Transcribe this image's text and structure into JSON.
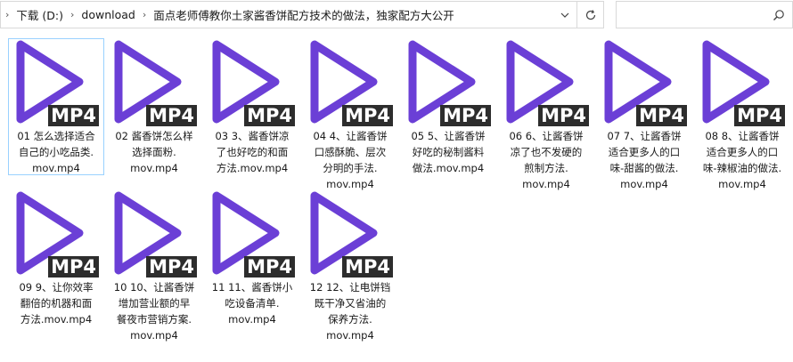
{
  "window": {
    "breadcrumb": [
      {
        "label": "下载 (D:)"
      },
      {
        "label": "download"
      },
      {
        "label": "面点老师傅教你土家酱香饼配方技术的做法，独家配方大公开"
      }
    ],
    "search": {
      "placeholder": ""
    }
  },
  "colors": {
    "play_icon": "#6b3fd6",
    "badge_bg": "#2d2d2d",
    "selection": "#99d1ff"
  },
  "files": [
    {
      "name": "01 怎么选择适合自己的小吃品类.mov.mp4",
      "lines": [
        "01 怎么选择适合",
        "自己的小吃品类.",
        "mov.mp4"
      ],
      "badge": "MP4",
      "icon": "play-icon",
      "selected": true
    },
    {
      "name": "02 酱香饼怎么样选择面粉.mov.mp4",
      "lines": [
        "02 酱香饼怎么样",
        "选择面粉.",
        "mov.mp4"
      ],
      "badge": "MP4",
      "icon": "play-icon"
    },
    {
      "name": "03 3、酱香饼凉了也好吃的和面方法.mov.mp4",
      "lines": [
        "03 3、酱香饼凉",
        "了也好吃的和面",
        "方法.mov.mp4"
      ],
      "badge": "MP4",
      "icon": "play-icon"
    },
    {
      "name": "04 4、让酱香饼口感酥脆、层次分明的手法.mov.mp4",
      "lines": [
        "04 4、让酱香饼",
        "口感酥脆、层次",
        "分明的手法.",
        "mov.mp4"
      ],
      "badge": "MP4",
      "icon": "play-icon"
    },
    {
      "name": "05 5、让酱香饼好吃的秘制酱料做法.mov.mp4",
      "lines": [
        "05 5、让酱香饼",
        "好吃的秘制酱料",
        "做法.mov.mp4"
      ],
      "badge": "MP4",
      "icon": "play-icon"
    },
    {
      "name": "06 6、让酱香饼凉了也不发硬的煎制方法.mov.mp4",
      "lines": [
        "06 6、让酱香饼",
        "凉了也不发硬的",
        "煎制方法.",
        "mov.mp4"
      ],
      "badge": "MP4",
      "icon": "play-icon"
    },
    {
      "name": "07 7、让酱香饼适合更多人的口味-甜酱的做法.mov.mp4",
      "lines": [
        "07 7、让酱香饼",
        "适合更多人的口",
        "味-甜酱的做法.",
        "mov.mp4"
      ],
      "badge": "MP4",
      "icon": "play-icon"
    },
    {
      "name": "08 8、让酱香饼适合更多人的口味-辣椒油的做法.mov.mp4",
      "lines": [
        "08 8、让酱香饼",
        "适合更多人的口",
        "味-辣椒油的做法.",
        "mov.mp4"
      ],
      "badge": "MP4",
      "icon": "play-icon"
    },
    {
      "name": "09 9、让你效率翻倍的机器和面方法.mov.mp4",
      "lines": [
        "09 9、让你效率",
        "翻倍的机器和面",
        "方法.mov.mp4"
      ],
      "badge": "MP4",
      "icon": "play-icon"
    },
    {
      "name": "10 10、让酱香饼增加营业额的早餐夜市营销方案.mov.mp4",
      "lines": [
        "10 10、让酱香饼",
        "增加营业额的早",
        "餐夜市营销方案.",
        "mov.mp4"
      ],
      "badge": "MP4",
      "icon": "play-icon"
    },
    {
      "name": "11 11、酱香饼小吃设备清单.mov.mp4",
      "lines": [
        "11 11、酱香饼小",
        "吃设备清单.",
        "mov.mp4"
      ],
      "badge": "MP4",
      "icon": "play-icon"
    },
    {
      "name": "12 12、让电饼铛既干净又省油的保养方法.mov.mp4",
      "lines": [
        "12 12、让电饼铛",
        "既干净又省油的",
        "保养方法.",
        "mov.mp4"
      ],
      "badge": "MP4",
      "icon": "play-icon"
    }
  ]
}
